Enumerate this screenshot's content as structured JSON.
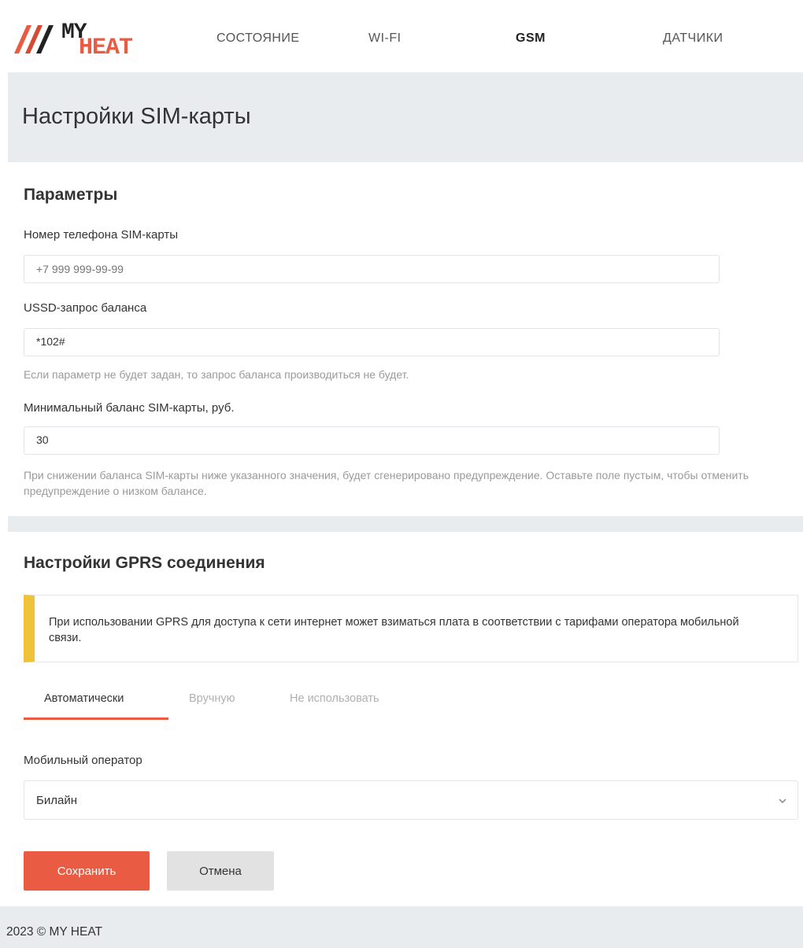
{
  "brand": {
    "my": "MY",
    "heat": "HEAT",
    "accent": "#ea5b43"
  },
  "nav": {
    "state": "СОСТОЯНИЕ",
    "wifi": "WI-FI",
    "gsm": "GSM",
    "sensors": "ДАТЧИКИ",
    "active": "GSM"
  },
  "header": {
    "title": "Настройки SIM-карты"
  },
  "params": {
    "title": "Параметры",
    "phone_label": "Номер телефона SIM-карты",
    "phone_placeholder": "+7 999 999-99-99",
    "phone_value": "",
    "ussd_label": "USSD-запрос баланса",
    "ussd_value": "*102#",
    "ussd_hint": "Если параметр не будет задан, то запрос баланса производиться не будет.",
    "minbal_label": "Минимальный баланс SIM-карты, руб.",
    "minbal_value": "30",
    "minbal_hint": "При снижении баланса SIM-карты ниже указанного значения, будет сгенерировано предупреждение. Оставьте поле пустым, чтобы отменить предупреждение о низком балансе."
  },
  "gprs": {
    "title": "Настройки GPRS соединения",
    "alert": "При использовании GPRS для доступа к сети интернет может взиматься плата в соответствии с тарифами оператора мобильной связи.",
    "alert_color": "#f0c23a",
    "tabs": [
      "Автоматически",
      "Вручную",
      "Не использовать"
    ],
    "active_tab": "Автоматически",
    "operator_label": "Мобильный оператор",
    "operator_value": "Билайн"
  },
  "actions": {
    "save": "Сохранить",
    "cancel": "Отмена"
  },
  "footer": {
    "text": "2023 © MY HEAT"
  }
}
